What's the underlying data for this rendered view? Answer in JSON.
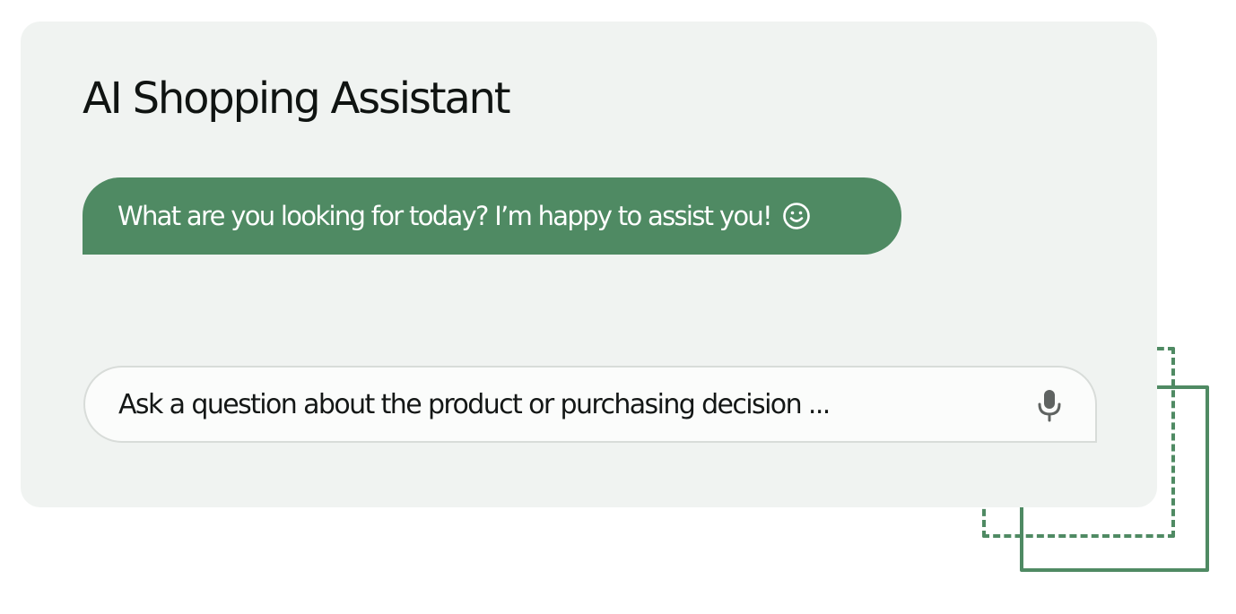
{
  "assistant": {
    "title": "AI Shopping Assistant",
    "greeting": "What are you looking for today? I’m happy to assist you!",
    "greeting_icon": "smile-icon"
  },
  "composer": {
    "placeholder": "Ask a question about the product or purchasing decision ...",
    "mic_icon": "microphone-icon"
  },
  "colors": {
    "accent": "#4f8a63",
    "card_background": "#f0f3f1",
    "input_background": "#fbfcfb",
    "text": "#101412"
  }
}
